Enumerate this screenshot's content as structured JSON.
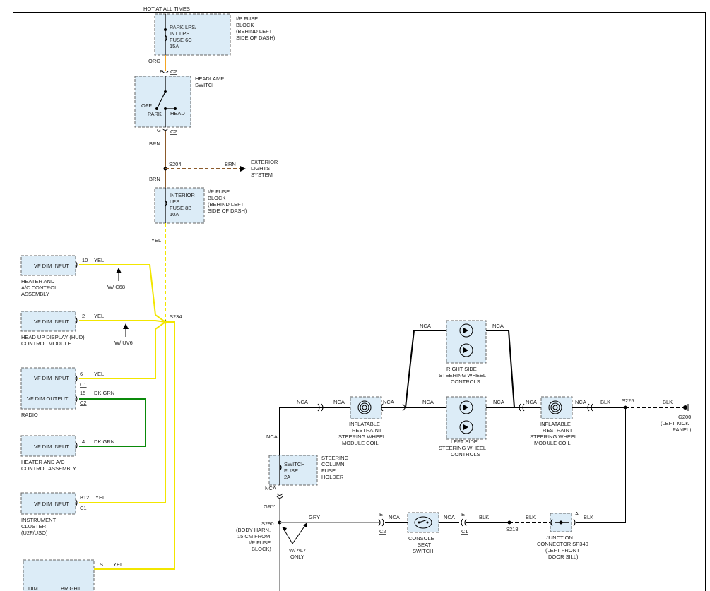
{
  "header": {
    "hot_at_all_times": "HOT AT ALL TIMES"
  },
  "fuse_park": {
    "lines": [
      "PARK LPS/",
      "INT LPS",
      "FUSE 6C",
      "15A"
    ]
  },
  "fuse_block_1": {
    "lines": [
      "I/P FUSE",
      "BLOCK",
      "(BEHIND LEFT",
      "SIDE OF DASH)"
    ]
  },
  "headlamp": {
    "org": "ORG",
    "e": "E",
    "c2_top": "C2",
    "title": [
      "HEADLAMP",
      "SWITCH"
    ],
    "off": "OFF",
    "park": "PARK",
    "head": "HEAD",
    "g": "G",
    "c2_bottom": "C2",
    "brn": "BRN"
  },
  "s204": {
    "label": "S204",
    "brn_top": "BRN",
    "brn_bottom": "BRN",
    "ext": [
      "EXTERIOR",
      "LIGHTS",
      "SYSTEM"
    ]
  },
  "fuse_interior": {
    "lines": [
      "INTERIOR",
      "LPS",
      "FUSE 8B",
      "10A"
    ],
    "block": [
      "I/P FUSE",
      "BLOCK",
      "(BEHIND LEFT",
      "SIDE OF DASH)"
    ],
    "yel": "YEL"
  },
  "splice_s234": "S234",
  "left_modules": [
    {
      "text": "VF DIM INPUT",
      "pin": "10",
      "wire": "YEL",
      "name": [
        "HEATER AND",
        "A/C CONTROL",
        "ASSEMBLY"
      ],
      "option": "W/ C68"
    },
    {
      "text": "VF DIM INPUT",
      "pin": "2",
      "wire": "YEL",
      "name": [
        "HEAD UP DISPLAY (HUD)",
        "CONTROL MODULE"
      ],
      "option": "W/ UV6"
    }
  ],
  "radio": {
    "in_text": "VF DIM INPUT",
    "in_pin": "6",
    "in_wire": "YEL",
    "in_conn": "C1",
    "out_text": "VF DIM OUTPUT",
    "out_pin": "15",
    "out_wire": "DK GRN",
    "out_conn": "C2",
    "name": "RADIO"
  },
  "heater2": {
    "text": "VF DIM INPUT",
    "pin": "4",
    "wire": "DK GRN",
    "name": [
      "HEATER AND A/C",
      "CONTROL ASSEMBLY"
    ]
  },
  "cluster": {
    "text": "VF DIM INPUT",
    "pin": "B12",
    "wire": "YEL",
    "conn": "C1",
    "name": [
      "INSTRUMENT",
      "CLUSTER",
      "(U2F/USO)"
    ]
  },
  "bottom_module": {
    "pin": "S",
    "wire": "YEL",
    "labels": [
      "DIM",
      "BRIGHT"
    ]
  },
  "steering": {
    "nca": "NCA",
    "right_controls": [
      "RIGHT SIDE",
      "STEERING WHEEL",
      "CONTROLS"
    ],
    "left_controls": [
      "LEFT SIDE",
      "STEERING WHEEL",
      "CONTROLS"
    ],
    "coil": [
      "INFLATABLE",
      "RESTRAINT",
      "STEERING WHEEL",
      "MODULE COIL"
    ],
    "blk": "BLK",
    "s225": "S225",
    "g200": [
      "G200",
      "(LEFT KICK",
      "PANEL)"
    ]
  },
  "switch_fuse": {
    "lines": [
      "SWITCH",
      "FUSE",
      "2A"
    ],
    "holder": [
      "STEERING",
      "COLUMN",
      "FUSE",
      "HOLDER"
    ],
    "nca": "NCA",
    "gry": "GRY"
  },
  "bottom_circuit": {
    "s290": [
      "S290",
      "(BODY HARN,",
      "15 CM FROM",
      "I/P FUSE",
      "BLOCK)"
    ],
    "gry": "GRY",
    "option": [
      "W/ AL7",
      "ONLY"
    ],
    "e1": "E",
    "c2": "C2",
    "nca": "NCA",
    "seat": [
      "CONSOLE",
      "SEAT",
      "SWITCH"
    ],
    "e2": "E",
    "c1": "C1",
    "blk": "BLK",
    "s218": "S218",
    "a": "A",
    "junction": [
      "JUNCTION",
      "CONNECTOR SP340",
      "(LEFT FRONT",
      "DOOR SILL)"
    ]
  }
}
